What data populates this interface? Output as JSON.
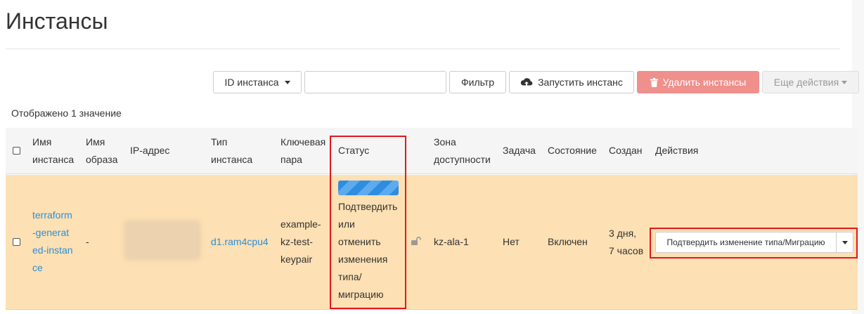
{
  "page": {
    "title": "Инстансы"
  },
  "toolbar": {
    "filter_field_select": "ID инстанса",
    "filter_input_value": "",
    "filter_button": "Фильтр",
    "launch_button": "Запустить инстанс",
    "delete_button": "Удалить инстансы",
    "more_actions_button": "Еще действия"
  },
  "table": {
    "count_text": "Отображено 1 значение",
    "headers": {
      "name": [
        "Имя",
        "инстанса"
      ],
      "image": [
        "Имя",
        "образа"
      ],
      "ip": "IP-адрес",
      "flavor": [
        "Тип",
        "инстанса"
      ],
      "keypair": [
        "Ключевая",
        "пара"
      ],
      "status": "Статус",
      "az": [
        "Зона",
        "доступности"
      ],
      "task": "Задача",
      "power": "Состояние",
      "created": "Создан",
      "actions": "Действия"
    },
    "rows": [
      {
        "name_lines": [
          "terraform",
          "-generat",
          "ed-instan",
          "ce"
        ],
        "image": "-",
        "flavor": "d1.ram4cpu4",
        "keypair_lines": [
          "example-",
          "kz-test-",
          "keypair"
        ],
        "status_lines": [
          "Подтвердить",
          "или",
          "отменить",
          "изменения",
          "типа/",
          "миграцию"
        ],
        "status_progress": 1.0,
        "az": "kz-ala-1",
        "task": "Нет",
        "power": "Включен",
        "created_lines": [
          "3 дня,",
          "7 часов"
        ],
        "action_label": "Подтвердить изменение типа/Миграцию"
      }
    ]
  },
  "colors": {
    "row_highlight": "#fde0b3",
    "link": "#2a8fd8",
    "danger": "#f0908c",
    "annotation": "#e2171d"
  }
}
